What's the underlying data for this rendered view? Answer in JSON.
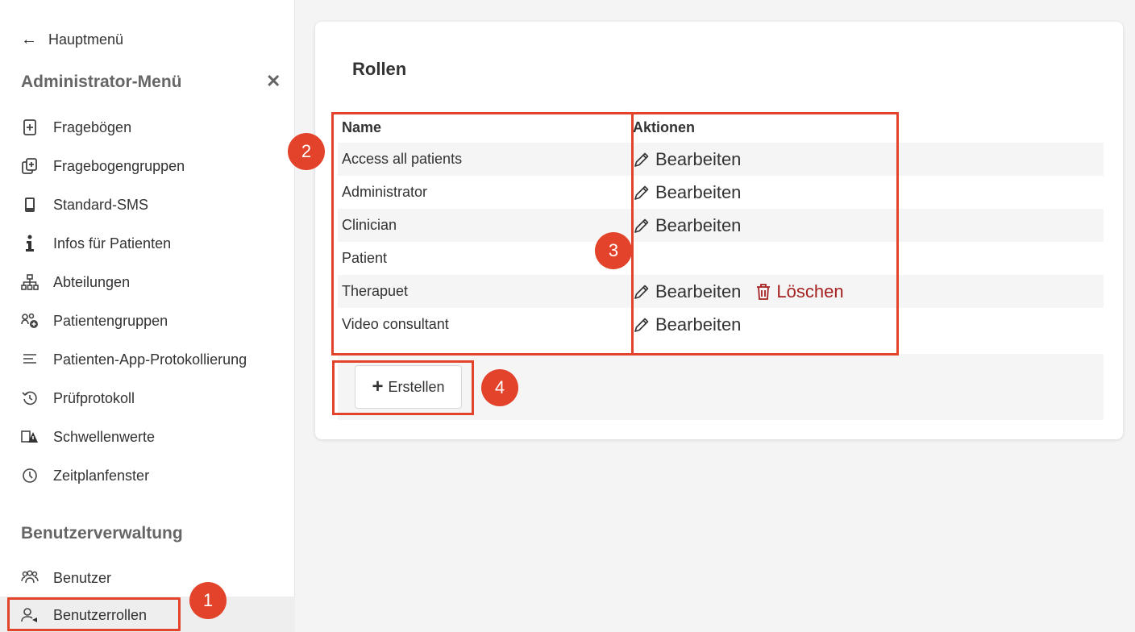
{
  "sidebar": {
    "back_label": "Hauptmenü",
    "menu_title": "Administrator-Menü",
    "close_symbol": "✕",
    "items": [
      {
        "label": "Fragebögen",
        "icon": "file-plus-icon"
      },
      {
        "label": "Fragebogengruppen",
        "icon": "files-plus-icon"
      },
      {
        "label": "Standard-SMS",
        "icon": "phone-icon"
      },
      {
        "label": "Infos für Patienten",
        "icon": "info-icon"
      },
      {
        "label": "Abteilungen",
        "icon": "org-chart-icon"
      },
      {
        "label": "Patientengruppen",
        "icon": "group-add-icon"
      },
      {
        "label": "Patienten-App-Protokollierung",
        "icon": "list-lines-icon"
      },
      {
        "label": "Prüfprotokoll",
        "icon": "history-icon"
      },
      {
        "label": "Schwellenwerte",
        "icon": "threshold-warning-icon"
      },
      {
        "label": "Zeitplanfenster",
        "icon": "clock-icon"
      }
    ],
    "section_title": "Benutzerverwaltung",
    "user_items": [
      {
        "label": "Benutzer",
        "icon": "users-icon"
      },
      {
        "label": "Benutzerrollen",
        "icon": "user-role-icon",
        "active": true
      }
    ]
  },
  "main": {
    "title": "Rollen",
    "columns": {
      "name": "Name",
      "actions": "Aktionen"
    },
    "rows": [
      {
        "name": "Access all patients",
        "edit": "Bearbeiten",
        "delete": ""
      },
      {
        "name": "Administrator",
        "edit": "Bearbeiten",
        "delete": ""
      },
      {
        "name": "Clinician",
        "edit": "Bearbeiten",
        "delete": ""
      },
      {
        "name": "Patient",
        "edit": "",
        "delete": ""
      },
      {
        "name": "Therapuet",
        "edit": "Bearbeiten",
        "delete": "Löschen"
      },
      {
        "name": "Video consultant",
        "edit": "Bearbeiten",
        "delete": ""
      }
    ],
    "create_label": "Erstellen"
  },
  "annotations": {
    "badge_1": "1",
    "badge_2": "2",
    "badge_3": "3",
    "badge_4": "4",
    "color": "#e2432a"
  }
}
